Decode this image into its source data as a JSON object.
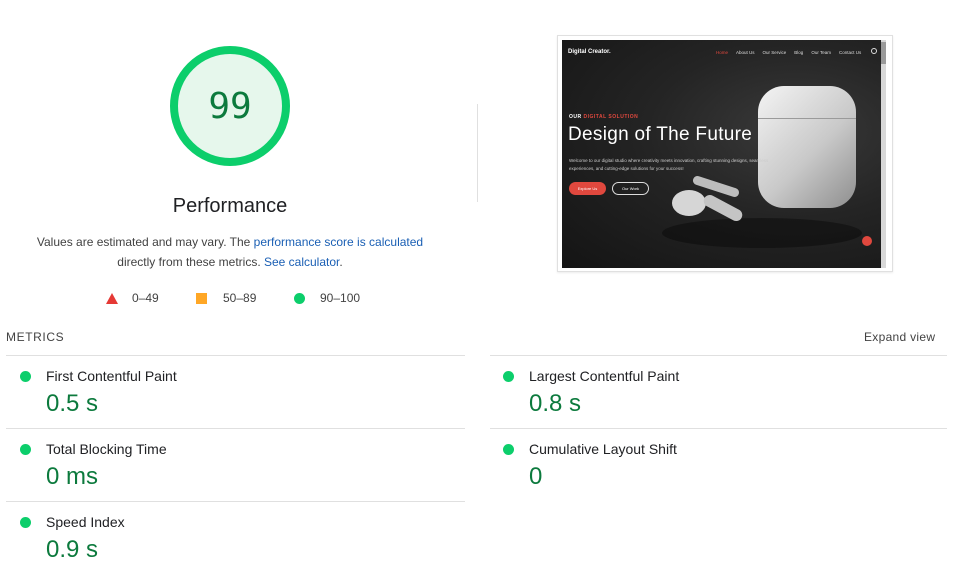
{
  "score": {
    "value": "99",
    "label": "Performance",
    "ring_color": "#0cce6b",
    "fill_color": "#e6f7ec",
    "text_color": "#0c7a3d"
  },
  "description": {
    "part1": "Values are estimated and may vary. The ",
    "link1": "performance score is calculated",
    "part2": " directly from these metrics. ",
    "link2": "See calculator",
    "part3": "."
  },
  "legend": [
    {
      "icon": "red-triangle-icon",
      "label": "0–49"
    },
    {
      "icon": "orange-square-icon",
      "label": "50–89"
    },
    {
      "icon": "green-circle-icon",
      "label": "90–100"
    }
  ],
  "screenshot": {
    "logo": "Digital Creator.",
    "nav": [
      "Home",
      "About Us",
      "Our Service",
      "Blog",
      "Our Team",
      "Contact Us"
    ],
    "kicker_prefix": "OUR ",
    "kicker_accent": "DIGITAL SOLUTION",
    "heading": "Design of The Future",
    "body": "Welcome to our digital studio where creativity meets innovation, crafting stunning designs, seamless experiences, and cutting-edge solutions for your success!",
    "button_primary": "Explore Us",
    "button_secondary": "Our Work"
  },
  "metrics": {
    "header": "METRICS",
    "expand": "Expand view",
    "items": [
      {
        "label": "First Contentful Paint",
        "value": "0.5 s",
        "status": "good"
      },
      {
        "label": "Largest Contentful Paint",
        "value": "0.8 s",
        "status": "good"
      },
      {
        "label": "Total Blocking Time",
        "value": "0 ms",
        "status": "good"
      },
      {
        "label": "Cumulative Layout Shift",
        "value": "0",
        "status": "good"
      },
      {
        "label": "Speed Index",
        "value": "0.9 s",
        "status": "good"
      }
    ]
  }
}
